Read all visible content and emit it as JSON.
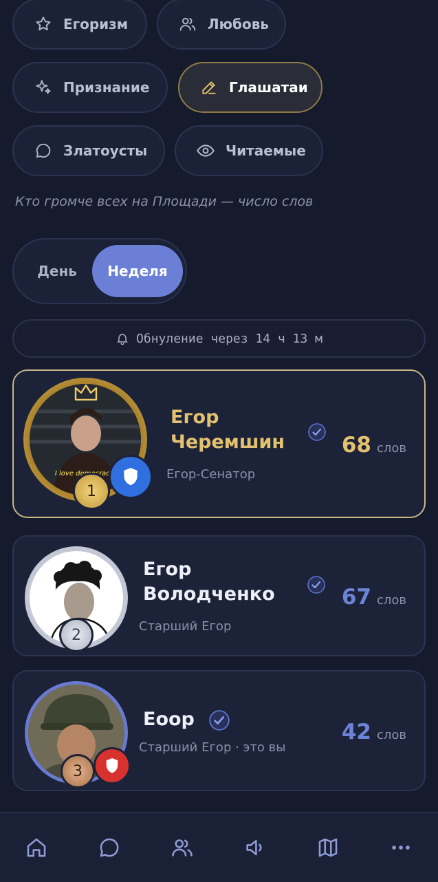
{
  "categories": [
    {
      "label": "Егоризм",
      "icon": "star-icon",
      "active": false
    },
    {
      "label": "Любовь",
      "icon": "users-icon",
      "active": false
    },
    {
      "label": "Признание",
      "icon": "sparkles-icon",
      "active": false
    },
    {
      "label": "Глашатаи",
      "icon": "pen-icon",
      "active": true
    },
    {
      "label": "Златоусты",
      "icon": "chat-icon",
      "active": false
    },
    {
      "label": "Читаемые",
      "icon": "eye-icon",
      "active": false
    }
  ],
  "subtitle": "Кто громче всех на Площади — число слов",
  "period": {
    "options": [
      "День",
      "Неделя"
    ],
    "selected": "Неделя"
  },
  "reset_text": "Обнуление через 14 ч 13 м",
  "leaderboard": [
    {
      "rank": "1",
      "name_line1": "Егор",
      "name_line2": "Черемшин",
      "role": "Егор-Сенатор",
      "score": "68",
      "unit": "слов",
      "avatar_caption": "I love democracy."
    },
    {
      "rank": "2",
      "name_line1": "Егор",
      "name_line2": "Володченко",
      "role": "Старший Егор",
      "score": "67",
      "unit": "слов"
    },
    {
      "rank": "3",
      "name_line1": "Еоор",
      "name_line2": "",
      "role": "Старший Егор · это вы",
      "score": "42",
      "unit": "слов"
    }
  ],
  "colors": {
    "gold": "#e2c16f",
    "accent": "#6b7fd7",
    "background": "#151a2d"
  },
  "nav": [
    "home-icon",
    "chat-icon",
    "people-icon",
    "speaker-icon",
    "map-icon",
    "more-icon"
  ]
}
